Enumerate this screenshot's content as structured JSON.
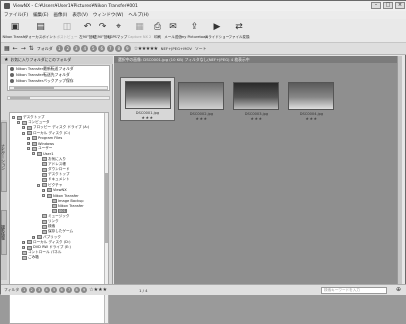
{
  "window": {
    "title": "ViewNX - C:¥Users¥User1¥Pictures¥Nikon Transfer¥001",
    "controls": [
      "–",
      "□",
      "×"
    ]
  },
  "menu": [
    "ファイル(F)",
    "編集(E)",
    "画像(I)",
    "表示(V)",
    "ウィンドウ(W)",
    "ヘルプ(H)"
  ],
  "toolbar": [
    {
      "icon": "▣",
      "label": "Nikon Transfer",
      "enabled": true
    },
    {
      "icon": "▤",
      "label": "フォーカスポイント",
      "enabled": true
    },
    {
      "icon": "◫",
      "label": "ポストビュー",
      "enabled": false
    },
    {
      "icon": "↶",
      "label": "左90°回転",
      "enabled": true
    },
    {
      "icon": "↷",
      "label": "右90°回転",
      "enabled": true
    },
    {
      "icon": "⌖",
      "label": "GPSマップ",
      "enabled": true
    },
    {
      "icon": "▦",
      "label": "Capture NX 2",
      "enabled": false
    },
    {
      "icon": "⎙",
      "label": "印刷",
      "enabled": true
    },
    {
      "icon": "✉",
      "label": "メール送信",
      "enabled": true
    },
    {
      "icon": "⇪",
      "label": "my Picturetown",
      "enabled": true
    },
    {
      "icon": "▶",
      "label": "スライドショー",
      "enabled": true
    },
    {
      "icon": "⇄",
      "label": "ファイル変換",
      "enabled": true
    }
  ],
  "navbar": {
    "icons": [
      "▦",
      "←",
      "→",
      "⇅"
    ],
    "folder_label": "フォルダ",
    "circles": [
      "1",
      "2",
      "3",
      "4",
      "5",
      "6",
      "7",
      "8",
      "9"
    ],
    "rating_filter": "☆★★★★★",
    "format_filter": "NEF+JPEG+MOV",
    "sort_label": "ソート"
  },
  "sidebar": {
    "header_label": "お気に入りフォルダにこのフォルダ",
    "favorites": [
      "Nikon Transfer最新転送フォルダ",
      "Nikon Transfer転送先フォルダ",
      "Nikon Transferバックアップ保存"
    ],
    "tabs": [
      "ナビゲーション",
      "撮影情報"
    ],
    "tree": [
      {
        "label": "デスクトップ",
        "level": 0,
        "exp": "–"
      },
      {
        "label": "コンピュータ",
        "level": 1,
        "exp": "–"
      },
      {
        "label": "フロッピー ディスク ドライブ (A:)",
        "level": 2,
        "exp": "+"
      },
      {
        "label": "ローカル ディスク (C:)",
        "level": 2,
        "exp": "–"
      },
      {
        "label": "Program Files",
        "level": 3,
        "exp": "+"
      },
      {
        "label": "Windows",
        "level": 3,
        "exp": "+"
      },
      {
        "label": "ユーザー",
        "level": 3,
        "exp": "–"
      },
      {
        "label": "User1",
        "level": 4,
        "exp": "–"
      },
      {
        "label": "お気に入り",
        "level": 5,
        "exp": ""
      },
      {
        "label": "アドレス帳",
        "level": 5,
        "exp": ""
      },
      {
        "label": "ダウンロード",
        "level": 5,
        "exp": ""
      },
      {
        "label": "デスクトップ",
        "level": 5,
        "exp": ""
      },
      {
        "label": "ドキュメント",
        "level": 5,
        "exp": ""
      },
      {
        "label": "ピクチャ",
        "level": 5,
        "exp": "–"
      },
      {
        "label": "ViewNX",
        "level": 6,
        "exp": "+"
      },
      {
        "label": "Nikon Transfer",
        "level": 6,
        "exp": "–"
      },
      {
        "label": "Image Backup",
        "level": 7,
        "exp": ""
      },
      {
        "label": "Nikon Transfer",
        "level": 7,
        "exp": ""
      },
      {
        "label": "001",
        "level": 7,
        "exp": "",
        "selected": true
      },
      {
        "label": "ミュージック",
        "level": 5,
        "exp": ""
      },
      {
        "label": "リンク",
        "level": 5,
        "exp": ""
      },
      {
        "label": "検索",
        "level": 5,
        "exp": ""
      },
      {
        "label": "保存したゲーム",
        "level": 5,
        "exp": ""
      },
      {
        "label": "パブリック",
        "level": 4,
        "exp": "+"
      },
      {
        "label": "ローカル ディスク (D:)",
        "level": 2,
        "exp": "+"
      },
      {
        "label": "DVD RW ドライブ (E:)",
        "level": 2,
        "exp": "+"
      },
      {
        "label": "コントロール パネル",
        "level": 1,
        "exp": ""
      },
      {
        "label": "ごみ箱",
        "level": 1,
        "exp": ""
      }
    ]
  },
  "main": {
    "header": "選択中の画像: DSC0001.jpg  (10 KB)  フィルタなし(NEF+JPEG) 4 枚表示中",
    "thumbnails": [
      {
        "filename": "DSC0001.jpg",
        "rating": "★★★",
        "selected": true,
        "colors": [
          "#3a3a3a",
          "#7a7a7a",
          "#dcdcdc"
        ]
      },
      {
        "filename": "DSC0002.jpg",
        "rating": "★★★",
        "selected": false,
        "colors": [
          "#6a6a6a",
          "#a0a0a0",
          "#d0d0d0"
        ]
      },
      {
        "filename": "DSC0003.jpg",
        "rating": "★★★",
        "selected": false,
        "colors": [
          "#2a2a2a",
          "#555555",
          "#bdbdbd"
        ]
      },
      {
        "filename": "DSC0004.jpg",
        "rating": "★★★",
        "selected": false,
        "colors": [
          "#5a5a5a",
          "#888888",
          "#e0e0e0"
        ]
      }
    ]
  },
  "statusbar": {
    "label": "フィルタ",
    "circles": [
      "1",
      "2",
      "3",
      "4",
      "5",
      "6",
      "7",
      "8",
      "9"
    ],
    "rating": "☆★★★",
    "page": "1 / 4",
    "search_placeholder": "検索キーワードを入力",
    "zoom_icon": "⊕"
  },
  "colors": {
    "accent": "#7a7a7a",
    "selection": "#d7d7d7"
  }
}
